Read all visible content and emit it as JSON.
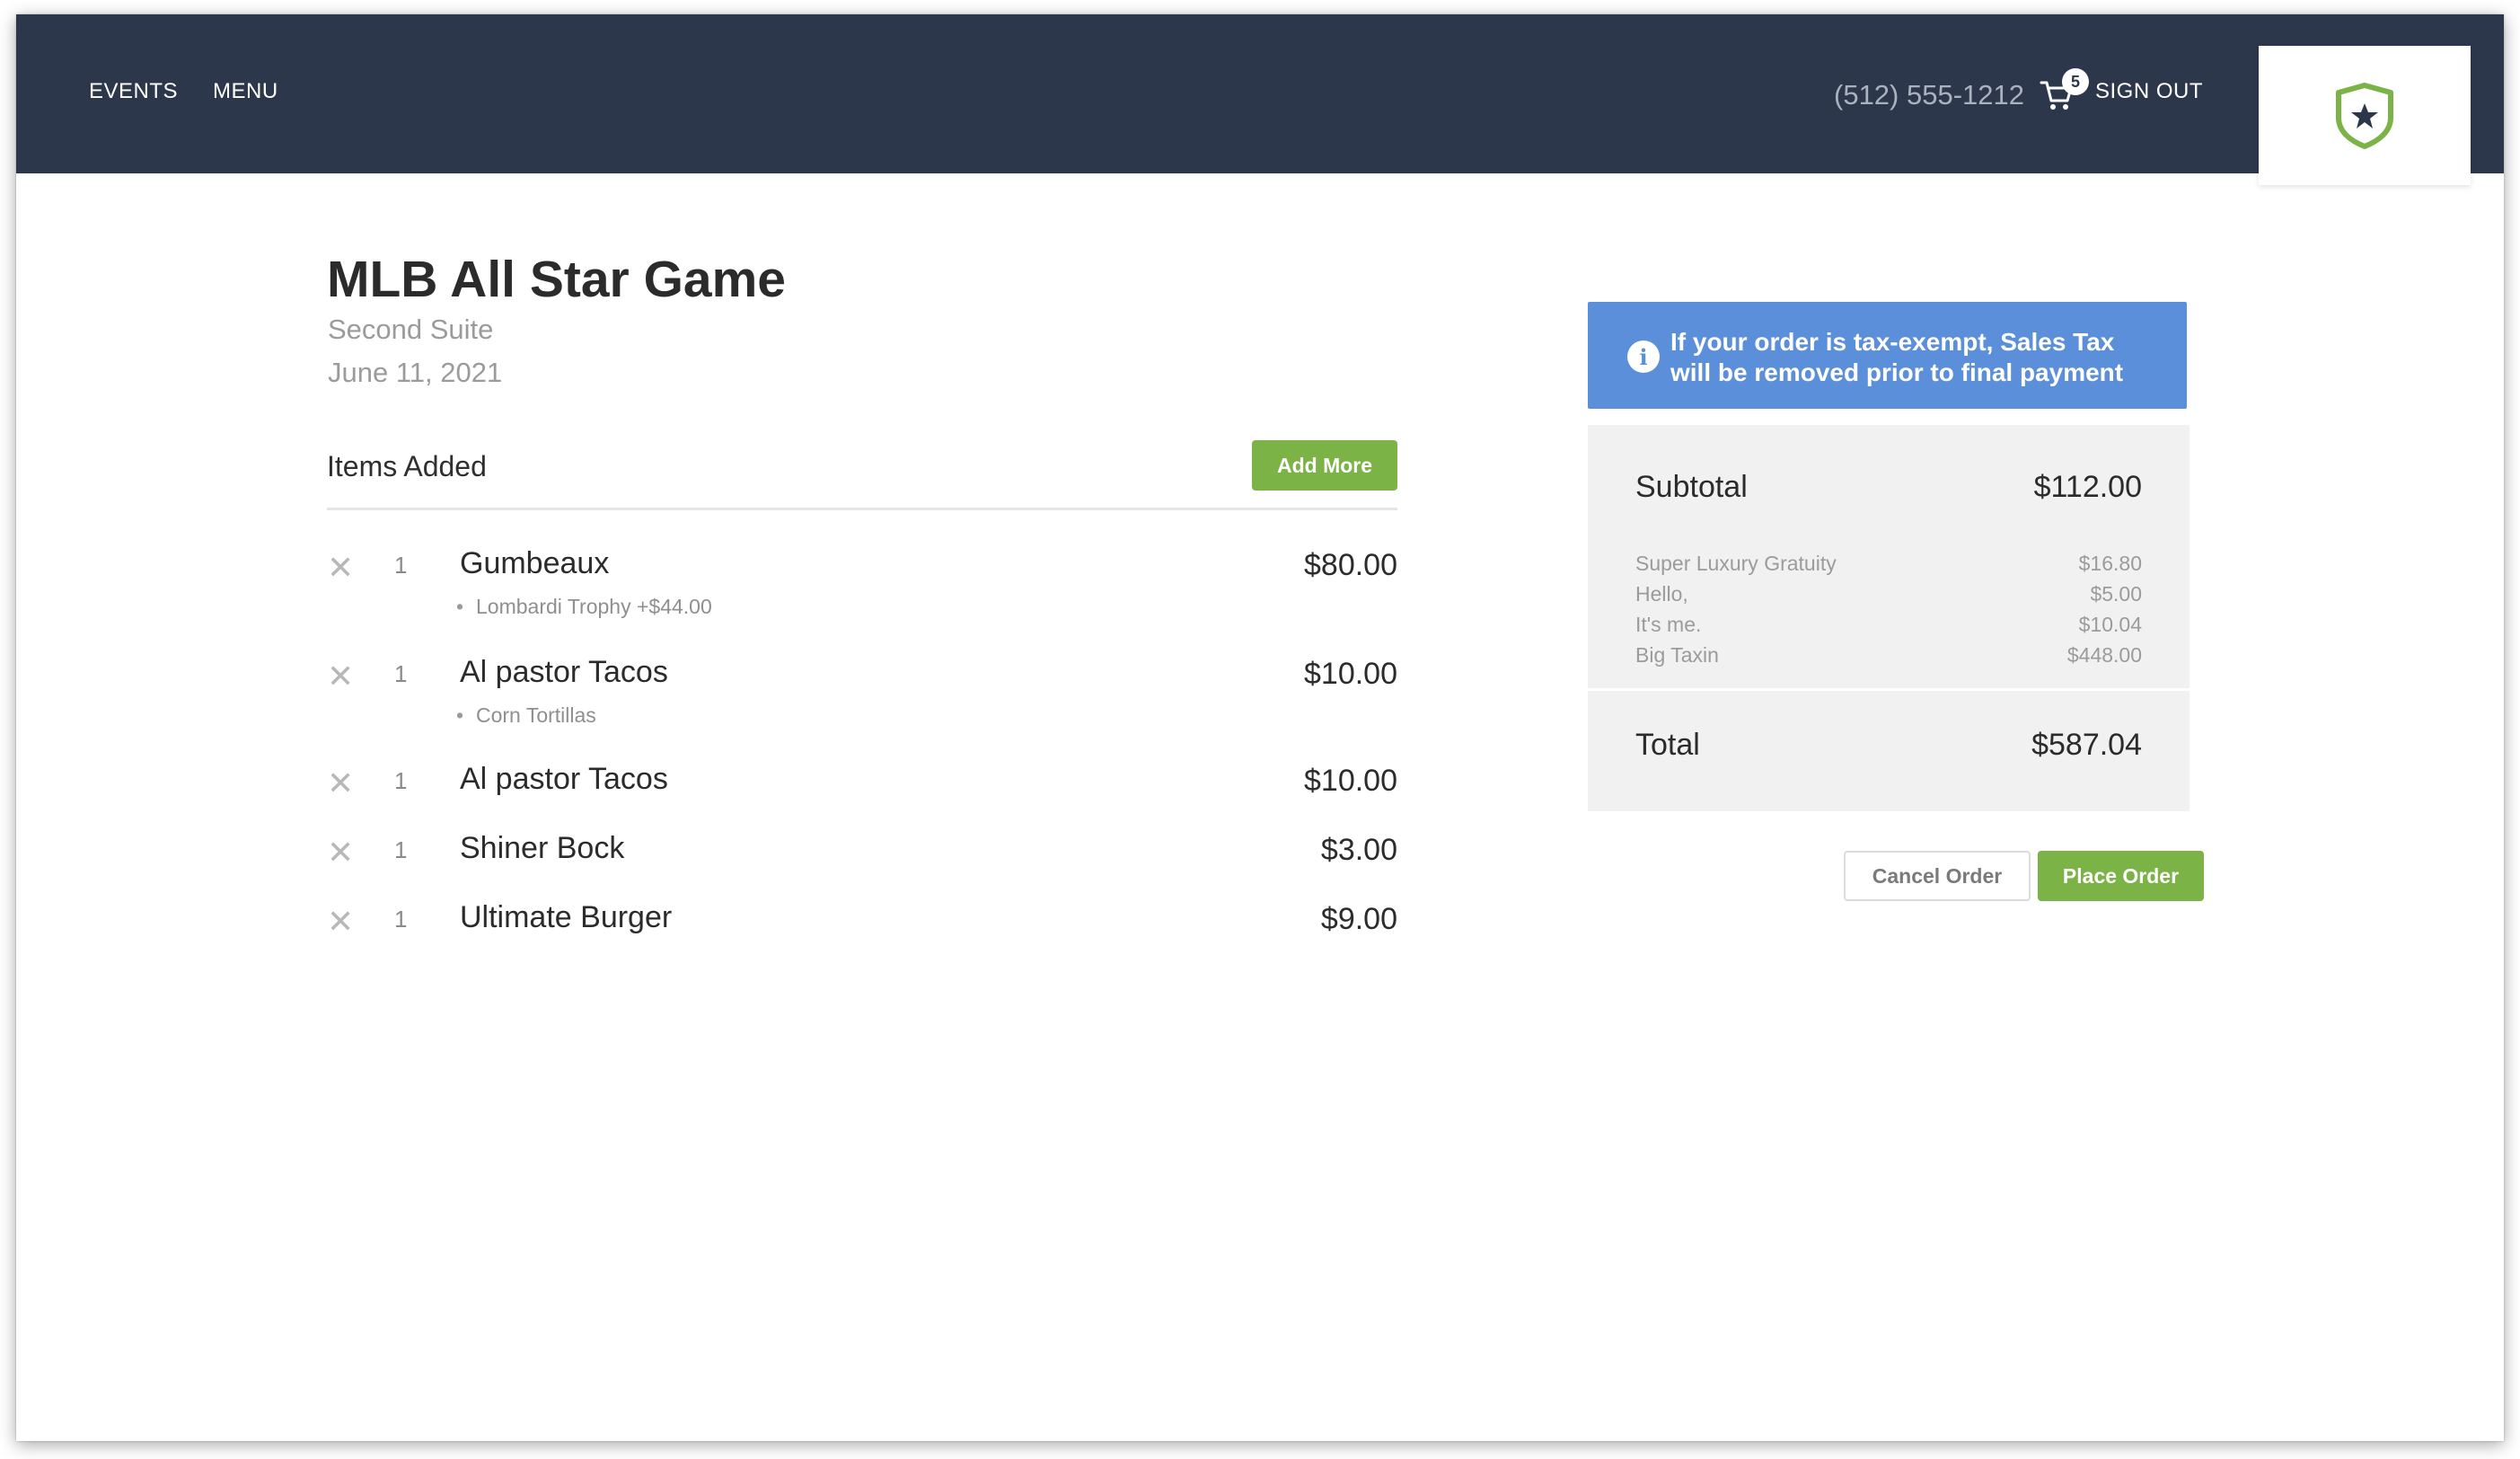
{
  "nav": {
    "links": [
      "EVENTS",
      "MENU"
    ],
    "phone": "(512) 555-1212",
    "cart_count": "5",
    "sign_out": "SIGN OUT",
    "logo": "shield-star-logo"
  },
  "event": {
    "title": "MLB All Star Game",
    "suite": "Second Suite",
    "date": "June 11, 2021"
  },
  "items_section": {
    "heading": "Items Added",
    "add_more_label": "Add More",
    "remove_glyph": "✕",
    "items": [
      {
        "qty": "1",
        "name": "Gumbeaux",
        "price": "$80.00",
        "modifier": "Lombardi Trophy +$44.00"
      },
      {
        "qty": "1",
        "name": "Al pastor Tacos",
        "price": "$10.00",
        "modifier": "Corn Tortillas"
      },
      {
        "qty": "1",
        "name": "Al pastor Tacos",
        "price": "$10.00"
      },
      {
        "qty": "1",
        "name": "Shiner Bock",
        "price": "$3.00"
      },
      {
        "qty": "1",
        "name": "Ultimate Burger",
        "price": "$9.00"
      }
    ]
  },
  "notice": {
    "icon": "info-icon",
    "text": "If your order is tax-exempt, Sales Tax will be removed prior to final payment"
  },
  "summary": {
    "subtotal_label": "Subtotal",
    "subtotal_value": "$112.00",
    "fees": [
      {
        "label": "Super Luxury Gratuity",
        "value": "$16.80"
      },
      {
        "label": "Hello,",
        "value": "$5.00"
      },
      {
        "label": "It's me.",
        "value": "$10.04"
      },
      {
        "label": "Big Taxin",
        "value": "$448.00"
      }
    ],
    "total_label": "Total",
    "total_value": "$587.04"
  },
  "actions": {
    "cancel_label": "Cancel Order",
    "place_label": "Place Order"
  },
  "colors": {
    "nav_bg": "#2d374b",
    "accent_green": "#7bb346",
    "notice_blue": "#5b8fd9",
    "summary_bg": "#f1f1f1"
  }
}
